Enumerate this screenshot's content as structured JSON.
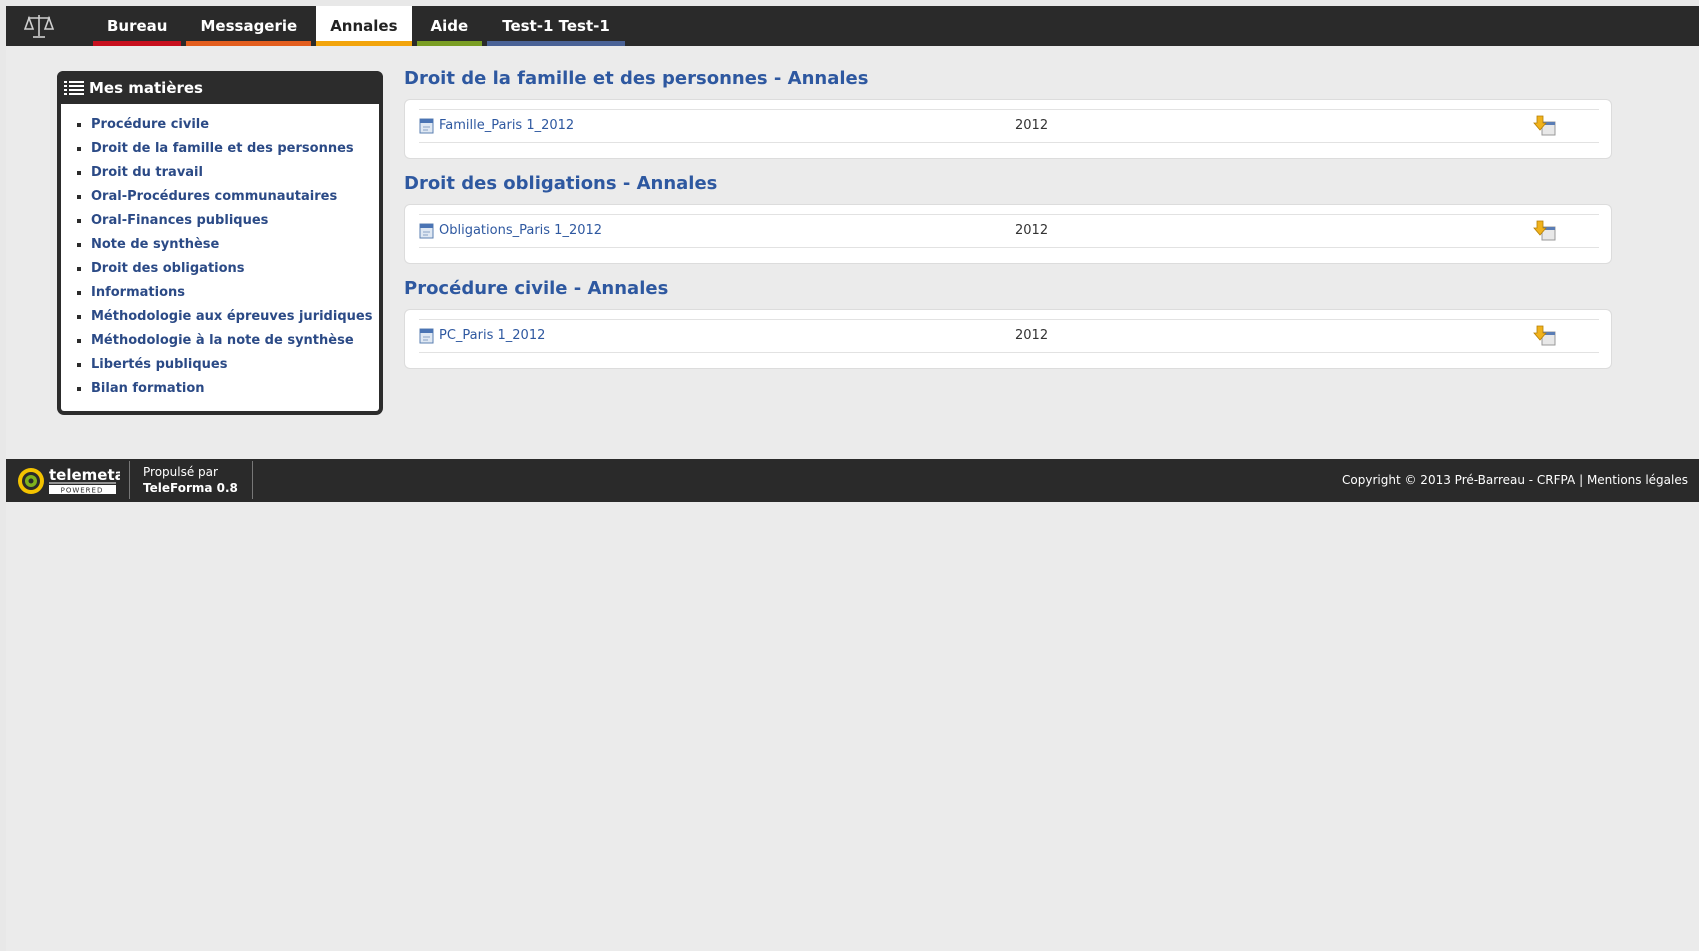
{
  "nav": {
    "tabs": [
      {
        "label": "Bureau",
        "color": "#c8101e",
        "active": false
      },
      {
        "label": "Messagerie",
        "color": "#e35e1e",
        "active": false
      },
      {
        "label": "Annales",
        "color": "#f2a40c",
        "active": true
      },
      {
        "label": "Aide",
        "color": "#7a9e24",
        "active": false
      },
      {
        "label": "Test-1 Test-1",
        "color": "#4a6296",
        "active": false
      }
    ]
  },
  "sidebar": {
    "title": "Mes matières",
    "items": [
      "Procédure civile",
      "Droit de la famille et des personnes",
      "Droit du travail",
      "Oral-Procédures communautaires",
      "Oral-Finances publiques",
      "Note de synthèse",
      "Droit des obligations",
      "Informations",
      "Méthodologie aux épreuves juridiques",
      "Méthodologie à la note de synthèse",
      "Libertés publiques",
      "Bilan formation"
    ]
  },
  "sections": [
    {
      "title": "Droit de la famille et des personnes - Annales",
      "doc": "Famille_Paris 1_2012",
      "year": "2012"
    },
    {
      "title": "Droit des obligations - Annales",
      "doc": "Obligations_Paris 1_2012",
      "year": "2012"
    },
    {
      "title": "Procédure civile - Annales",
      "doc": "PC_Paris 1_2012",
      "year": "2012"
    }
  ],
  "footer": {
    "logo_text": "telemeta",
    "logo_sub": "POWERED",
    "powered_label": "Propulsé par",
    "powered_product": "TeleForma 0.8",
    "copyright": "Copyright © 2013 Pré-Barreau - CRFPA",
    "separator": "|",
    "legal_link": "Mentions légales"
  },
  "colors": {
    "link": "#2e58a0",
    "sidebar_link": "#2b4a86",
    "dark": "#2a2a2a"
  }
}
